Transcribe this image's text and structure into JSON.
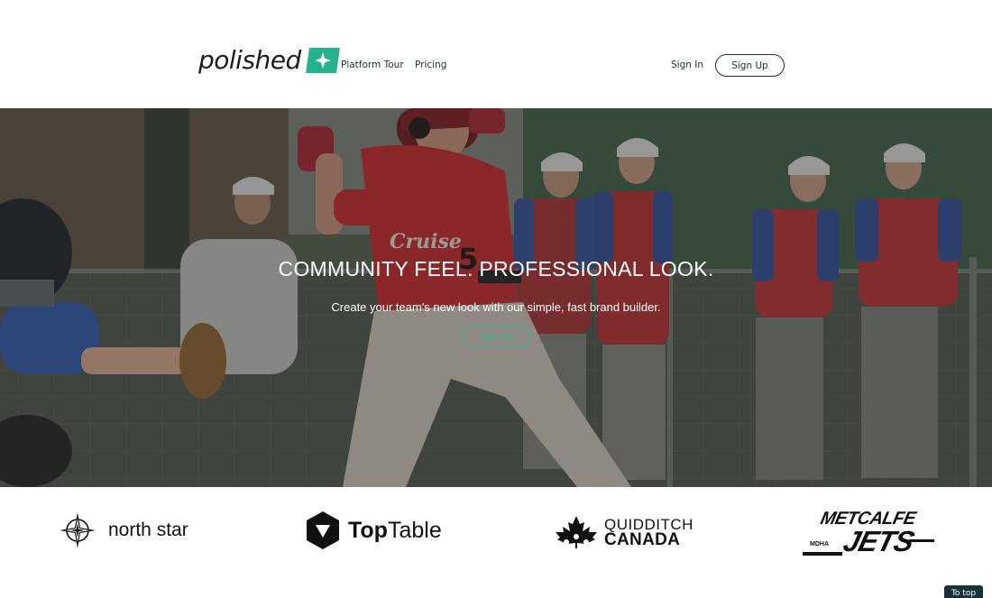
{
  "header": {
    "logo_text": "polished",
    "nav": {
      "platform_tour": "Platform Tour",
      "pricing": "Pricing"
    },
    "sign_in": "Sign In",
    "sign_up": "Sign Up"
  },
  "hero": {
    "title": "COMMUNITY FEEL. PROFESSIONAL LOOK.",
    "subtitle": "Create your team's new look with our simple, fast brand builder.",
    "cta": "Sign Up",
    "jersey_text": "Cruise",
    "jersey_number": "5"
  },
  "logos": {
    "north_star": "north star",
    "top_table_bold": "Top",
    "top_table_light": "Table",
    "quidditch_line1": "QUIDDITCH",
    "quidditch_line2": "CANADA",
    "metcalfe_line1": "METCALFE",
    "metcalfe_line2": "JETS",
    "metcalfe_small": "MDHA"
  },
  "to_top": "To top",
  "colors": {
    "brand_green": "#24b28e",
    "navy": "#17323a",
    "cta_teal": "#2fb596"
  }
}
